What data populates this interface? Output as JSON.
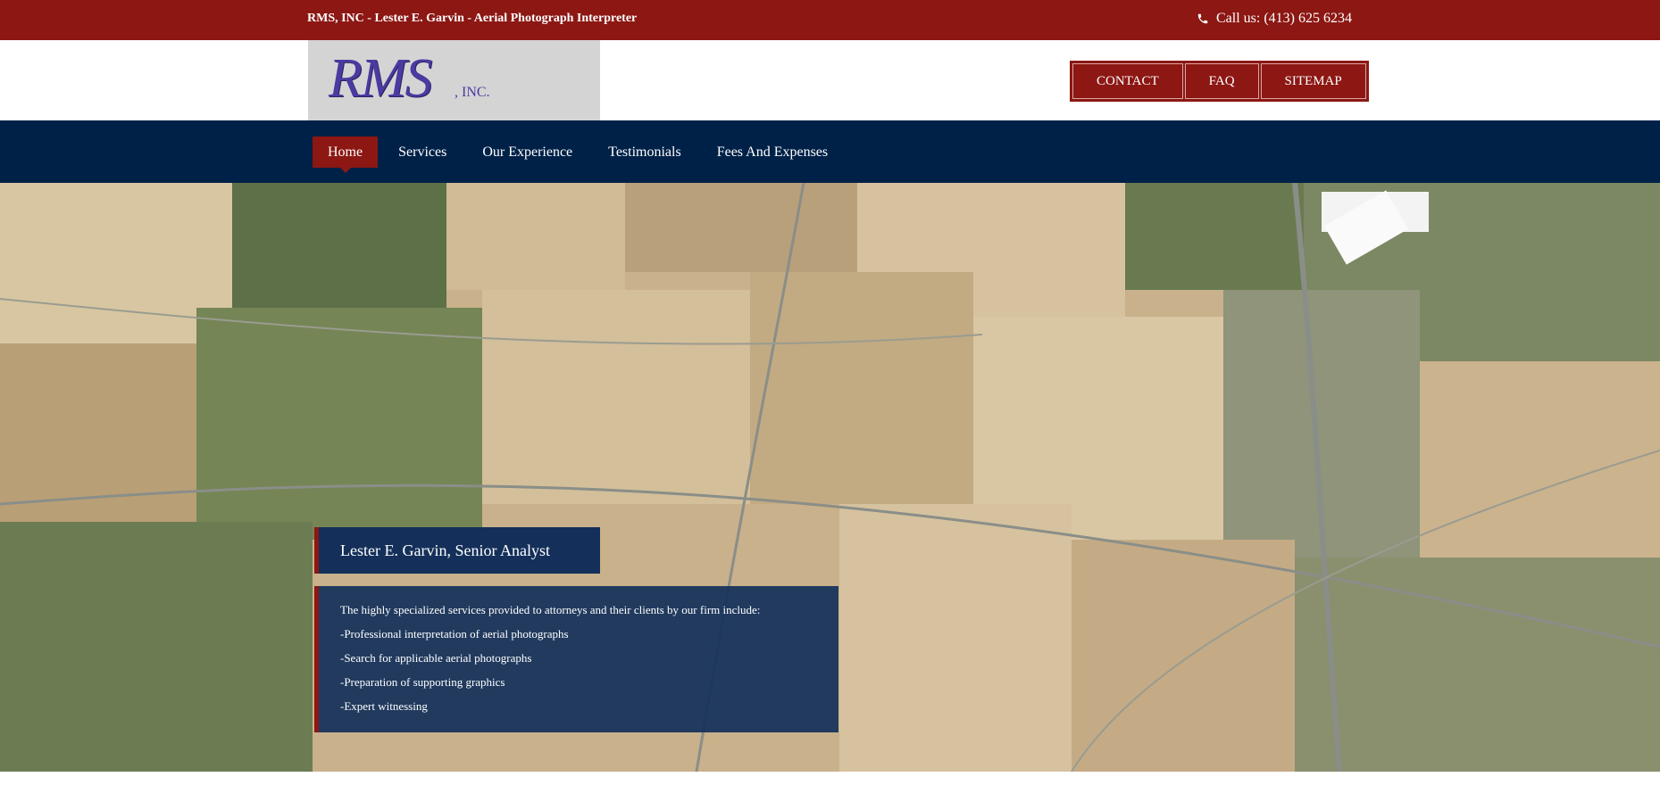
{
  "topbar": {
    "tagline": "RMS, INC - Lester E. Garvin - Aerial Photograph Interpreter",
    "phone_label": "Call us: (413) 625 6234",
    "phone_icon": "phone-icon"
  },
  "logo": {
    "main": "RMS",
    "suffix": ", INC."
  },
  "util_nav": {
    "items": [
      "CONTACT",
      "FAQ",
      "SITEMAP"
    ]
  },
  "main_nav": {
    "items": [
      "Home",
      "Services",
      "Our Experience",
      "Testimonials",
      "Fees And Expenses"
    ],
    "active": "Home"
  },
  "hero": {
    "title": "Lester E. Garvin, Senior Analyst",
    "lines": [
      "The highly specialized services provided to attorneys and their clients by our firm include:",
      "-Professional interpretation of aerial photographs",
      "-Search for applicable aerial photographs",
      "-Preparation of supporting graphics",
      "-Expert witnessing"
    ]
  },
  "colors": {
    "brand_red": "#8c1713",
    "navy": "#002147",
    "box_navy": "#14305a",
    "logo_purple": "#4b3aa0"
  }
}
